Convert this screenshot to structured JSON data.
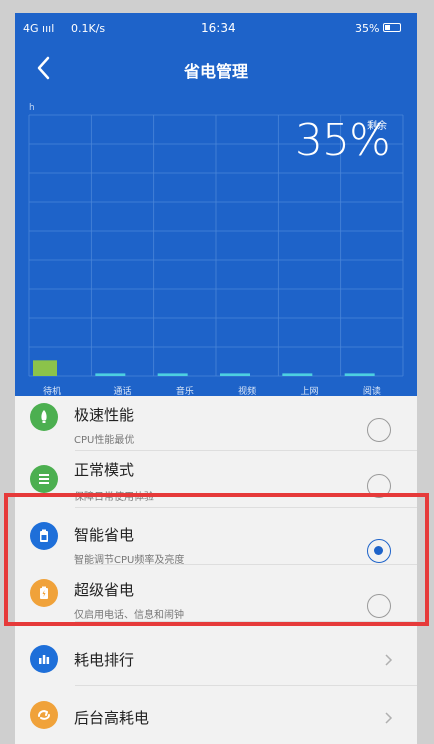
{
  "status_bar": {
    "network": "4G ıııl",
    "speed": "0.1K/s",
    "time": "16:34",
    "battery_percent": "35%"
  },
  "header": {
    "title": "省电管理"
  },
  "chart": {
    "battery_value": "35%",
    "battery_label": "剩余",
    "unit_label": "h",
    "categories": [
      "待机",
      "通话",
      "音乐",
      "视频",
      "上网",
      "阅读"
    ]
  },
  "chart_data": {
    "type": "bar",
    "categories": [
      "待机",
      "通话",
      "音乐",
      "视频",
      "上网",
      "阅读"
    ],
    "values": [
      0.3,
      0.05,
      0.05,
      0.05,
      0.05,
      0.05
    ],
    "ylabel": "h",
    "grid": true,
    "colors": [
      "#8bc34a",
      "#4dd0e1",
      "#4dd0e1",
      "#4dd0e1",
      "#4dd0e1",
      "#4dd0e1"
    ]
  },
  "modes": [
    {
      "title": "极速性能",
      "subtitle": "CPU性能最优",
      "icon": "rocket-icon",
      "color": "#4caf50",
      "selected": false
    },
    {
      "title": "正常模式",
      "subtitle": "保障日常使用体验",
      "icon": "list-icon",
      "color": "#4caf50",
      "selected": false
    },
    {
      "title": "智能省电",
      "subtitle": "智能调节CPU频率及亮度",
      "icon": "battery-icon",
      "color": "#1e6fd9",
      "selected": true
    },
    {
      "title": "超级省电",
      "subtitle": "仅启用电话、信息和闹钟",
      "icon": "power-save-icon",
      "color": "#f0a23a",
      "selected": false
    }
  ],
  "links": [
    {
      "title": "耗电排行",
      "icon": "bar-chart-icon",
      "color": "#1e6fd9"
    },
    {
      "title": "后台高耗电",
      "icon": "refresh-icon",
      "color": "#f0a23a"
    }
  ]
}
